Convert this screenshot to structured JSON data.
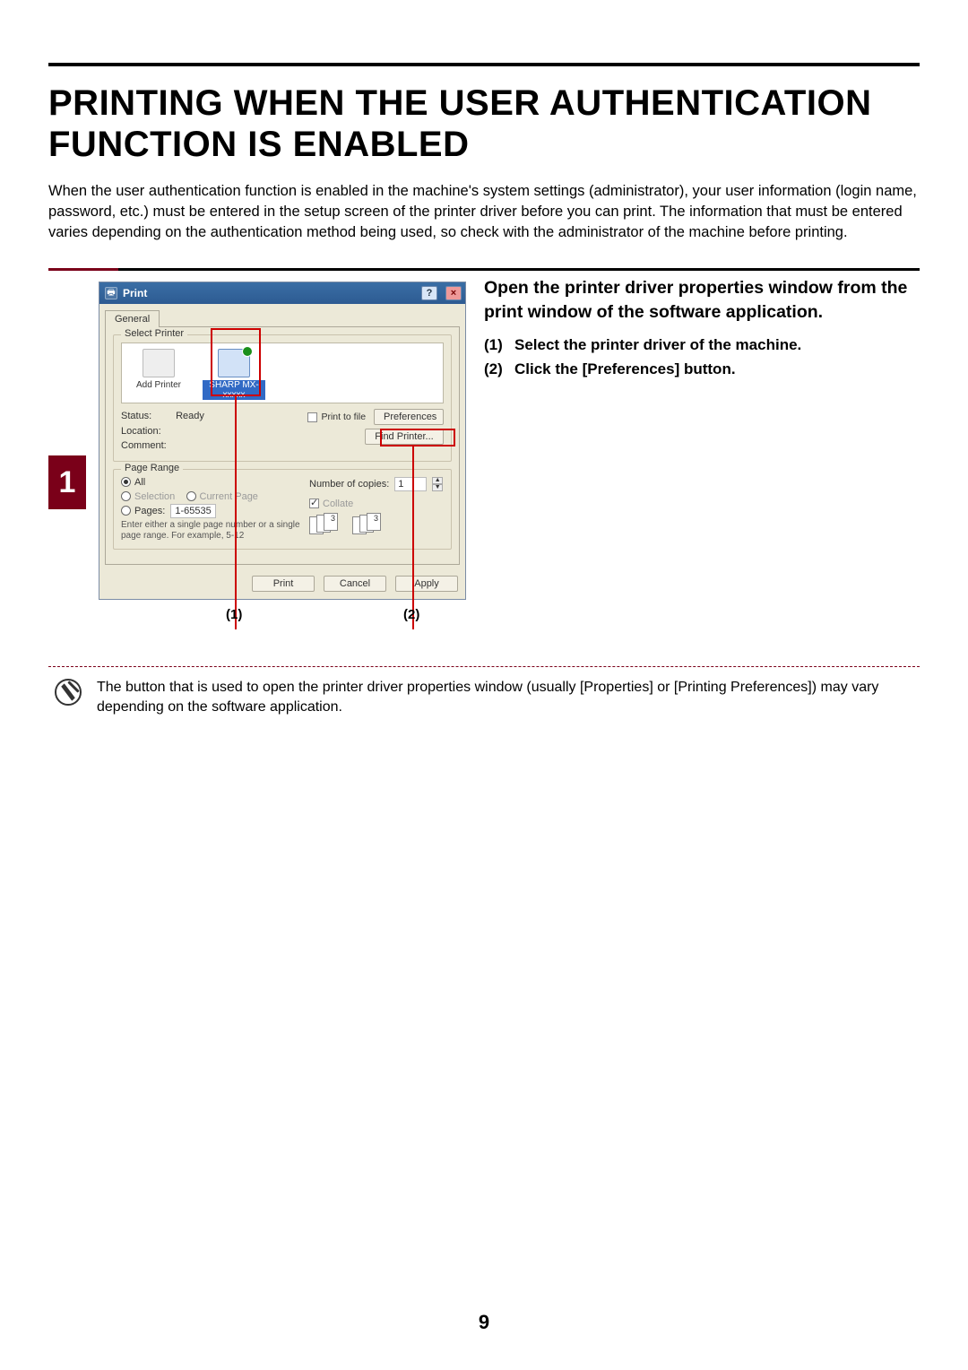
{
  "doc": {
    "title": "PRINTING WHEN THE USER AUTHENTICATION FUNCTION IS ENABLED",
    "intro": "When the user authentication function is enabled in the machine's system settings (administrator), your user information (login name, password, etc.) must be entered in the setup screen of the printer driver before you can print. The information that must be entered varies depending on the authentication method being used, so check with the administrator of the machine before printing."
  },
  "step": {
    "number": "1",
    "lead": "Open the printer driver properties window from the print window of the software application.",
    "items": [
      {
        "num": "(1)",
        "text": "Select the printer driver of the machine."
      },
      {
        "num": "(2)",
        "text": "Click the [Preferences] button."
      }
    ]
  },
  "dialog": {
    "title": "Print",
    "tab": "General",
    "group_printer": "Select Printer",
    "printers": [
      {
        "label": "Add Printer",
        "selected": false
      },
      {
        "label": "SHARP MX-xxxxx",
        "selected": true
      }
    ],
    "status_label": "Status:",
    "status_value": "Ready",
    "location_label": "Location:",
    "comment_label": "Comment:",
    "print_to_file": "Print to file",
    "preferences": "Preferences",
    "find_printer": "Find Printer...",
    "group_range": "Page Range",
    "range_all": "All",
    "range_selection": "Selection",
    "range_current": "Current Page",
    "range_pages": "Pages:",
    "range_pages_value": "1-65535",
    "range_help": "Enter either a single page number or a single page range.  For example, 5-12",
    "copies_label": "Number of copies:",
    "copies_value": "1",
    "collate": "Collate",
    "btn_print": "Print",
    "btn_cancel": "Cancel",
    "btn_apply": "Apply"
  },
  "callouts": {
    "c1": "(1)",
    "c2": "(2)"
  },
  "note": "The button that is used to open the printer driver properties window (usually [Properties] or [Printing Preferences]) may vary depending on the software application.",
  "page_number": "9"
}
